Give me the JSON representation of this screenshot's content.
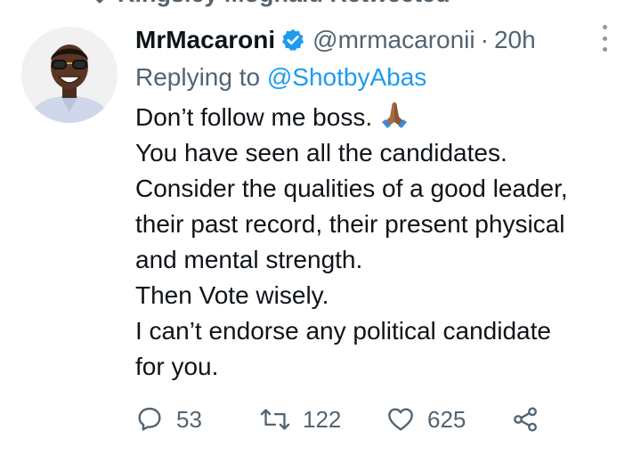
{
  "retweet_context": {
    "text": "Kingsley Moghalu Retweeted"
  },
  "tweet": {
    "author_name": "MrMacaroni",
    "handle": "@mrmacaronii",
    "separator": "·",
    "time": "20h",
    "reply_prefix": "Replying to",
    "reply_to": "@ShotbyAbas",
    "lines": [
      "Don’t follow me boss.",
      "You have seen all the candidates.",
      "Consider the qualities of a good leader,",
      "their past record, their present physical",
      "and mental strength.",
      "Then Vote wisely.",
      "I can’t endorse any political candidate",
      "for you."
    ],
    "emoji_name": "folded-hands"
  },
  "actions": {
    "replies": "53",
    "retweets": "122",
    "likes": "625"
  },
  "colors": {
    "text": "#0f1419",
    "secondary": "#536471",
    "link": "#1d9bf0",
    "verified": "#1d9bf0"
  },
  "icons": [
    "retweet-icon",
    "verified-badge-icon",
    "more-options-icon",
    "reply-icon",
    "retweet-icon",
    "like-icon",
    "share-icon",
    "folded-hands-emoji"
  ]
}
